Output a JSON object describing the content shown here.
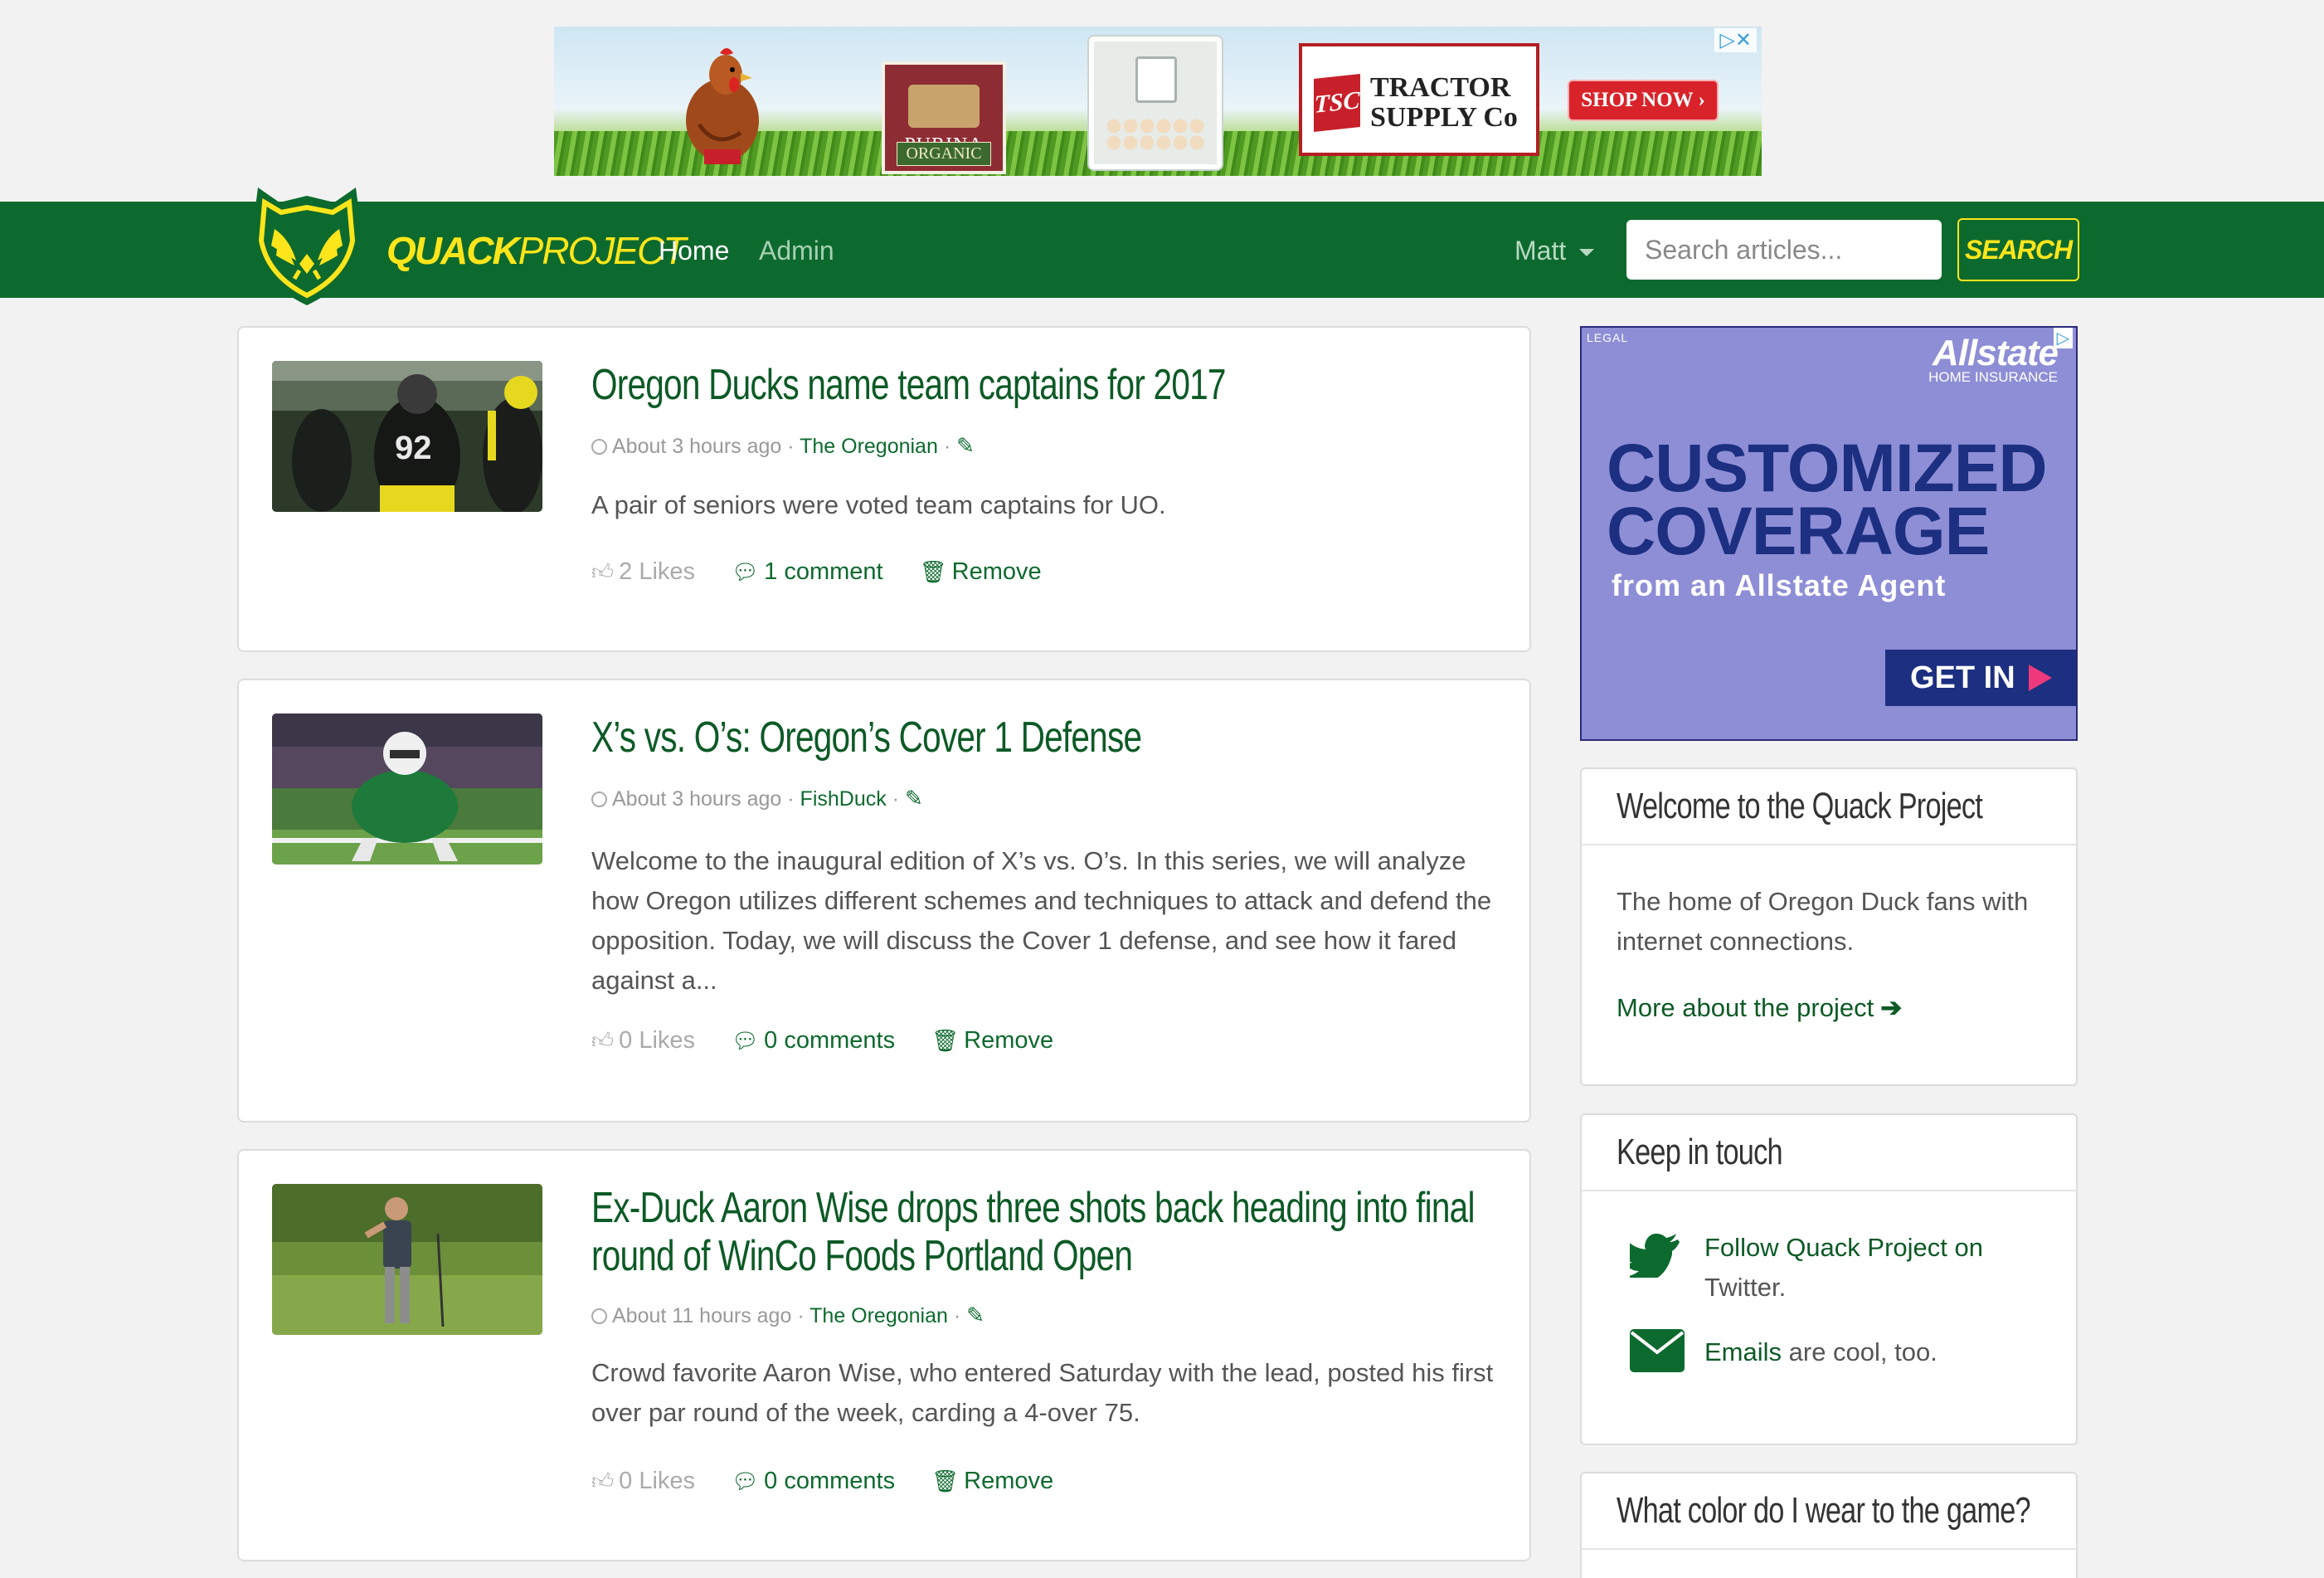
{
  "top_ad": {
    "purina_text": "PURINA",
    "organic_text": "ORGANIC",
    "tsc_mark": "TSC",
    "tsc_name": "TRACTOR SUPPLY Co",
    "cta": "SHOP NOW ›",
    "adchoices": "▷✕"
  },
  "nav": {
    "brand_bold": "QUACK",
    "brand_light": "PROJECT",
    "links": [
      "Home",
      "Admin"
    ],
    "user": "Matt",
    "search_placeholder": "Search articles...",
    "search_button": "SEARCH"
  },
  "articles": [
    {
      "title": "Oregon Ducks name team captains for 2017",
      "time": "About 3 hours ago",
      "source": "The Oregonian",
      "summary": "A pair of seniors were voted team captains for UO.",
      "likes": "2 Likes",
      "comments": "1 comment",
      "remove": "Remove"
    },
    {
      "title": "X’s vs. O’s: Oregon’s Cover 1 Defense",
      "time": "About 3 hours ago",
      "source": "FishDuck",
      "summary": "Welcome to the inaugural edition of X’s vs. O’s. In this series, we will analyze how Oregon utilizes different schemes and techniques to attack and defend the opposition. Today, we will discuss the Cover 1 defense, and see how it fared against a...",
      "likes": "0 Likes",
      "comments": "0 comments",
      "remove": "Remove"
    },
    {
      "title": "Ex-Duck Aaron Wise drops three shots back heading into final round of WinCo Foods Portland Open",
      "time": "About 11 hours ago",
      "source": "The Oregonian",
      "summary": "Crowd favorite Aaron Wise, who entered Saturday with the lead, posted his first over par round of the week, carding a 4-over 75.",
      "likes": "0 Likes",
      "comments": "0 comments",
      "remove": "Remove"
    }
  ],
  "side_ad": {
    "legal": "LEGAL",
    "brand": "Allstate",
    "brand_sub": "HOME INSURANCE",
    "headline_1": "CUSTOMIZED",
    "headline_2": "COVERAGE",
    "sub": "from an Allstate Agent",
    "cta": "GET IN",
    "adchoice": "▷"
  },
  "panels": {
    "welcome": {
      "title": "Welcome to the Quack Project",
      "text": "The home of Oregon Duck fans with internet connections.",
      "link": "More about the project"
    },
    "touch": {
      "title": "Keep in touch",
      "twitter_link": "Follow Quack Project on",
      "twitter_rest": "Twitter.",
      "email_link": "Emails",
      "email_rest": " are cool, too."
    },
    "color": {
      "title": "What color do I wear to the game?"
    }
  },
  "colors": {
    "brand_green": "#0d6a2e",
    "brand_yellow": "#fde51b",
    "link_green": "#0d5a26",
    "ad_purple": "#8e8ed6",
    "ad_navy": "#1c2f80"
  }
}
